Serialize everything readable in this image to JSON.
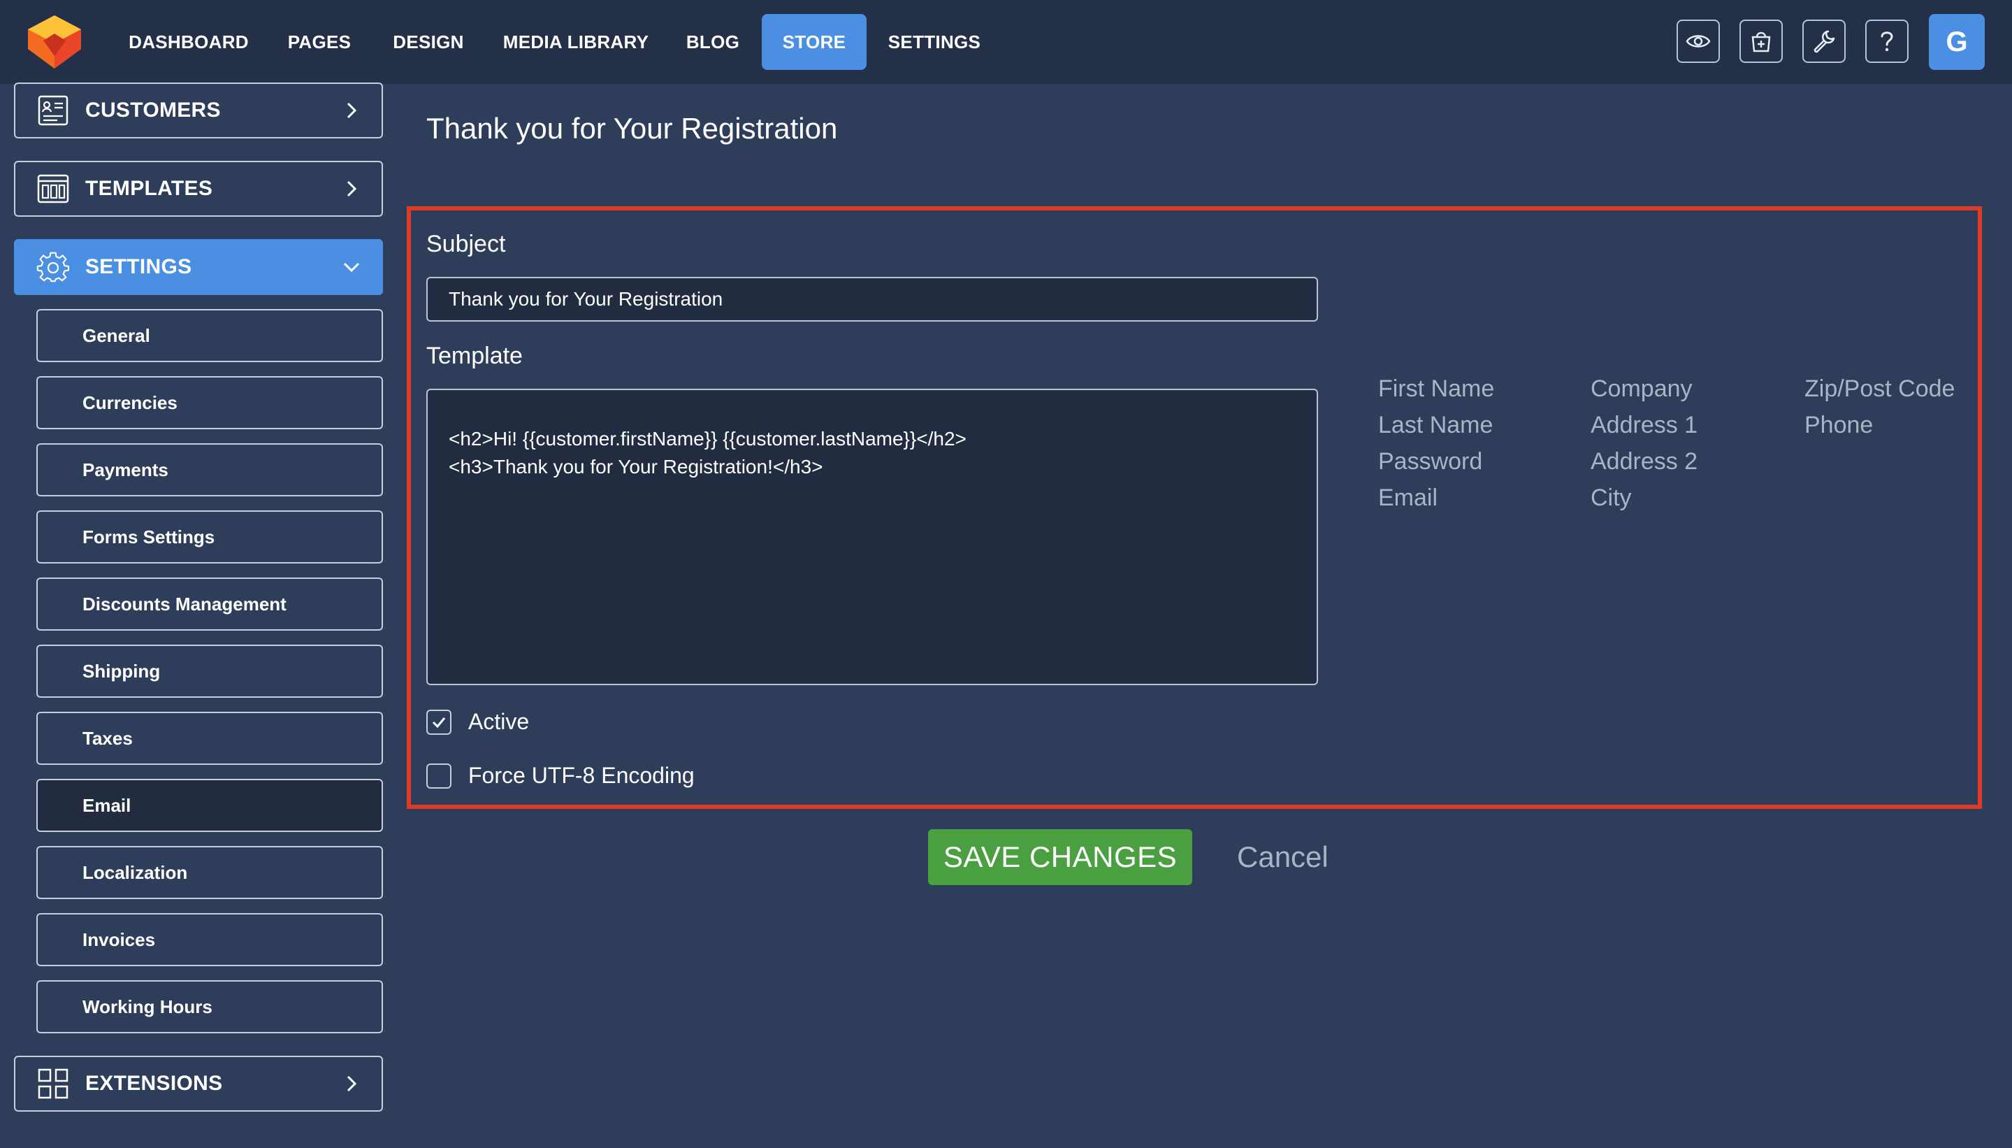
{
  "nav": {
    "items": [
      {
        "label": "DASHBOARD"
      },
      {
        "label": "PAGES"
      },
      {
        "label": "DESIGN"
      },
      {
        "label": "MEDIA LIBRARY"
      },
      {
        "label": "BLOG"
      },
      {
        "label": "STORE",
        "active": true
      },
      {
        "label": "SETTINGS"
      }
    ],
    "tools": [
      "eye-icon",
      "store-add-icon",
      "wrench-icon",
      "help-icon"
    ],
    "avatar_letter": "G"
  },
  "sidebar": {
    "sections": {
      "customers": "CUSTOMERS",
      "templates": "TEMPLATES",
      "settings": "SETTINGS",
      "extensions": "EXTENSIONS"
    },
    "settings_items": [
      "General",
      "Currencies",
      "Payments",
      "Forms Settings",
      "Discounts Management",
      "Shipping",
      "Taxes",
      "Email",
      "Localization",
      "Invoices",
      "Working Hours"
    ],
    "selected_item": "Email"
  },
  "main": {
    "title": "Thank you for Your Registration",
    "subject_label": "Subject",
    "subject_value": "Thank you for Your Registration",
    "template_label": "Template",
    "template_value": "<h2>Hi! {{customer.firstName}} {{customer.lastName}}</h2>\n<h3>Thank you for Your Registration!</h3>",
    "variables": {
      "col1": [
        "First Name",
        "Last Name",
        "Password",
        "Email"
      ],
      "col2": [
        "Company",
        "Address 1",
        "Address 2",
        "City"
      ],
      "col3": [
        "Zip/Post Code",
        "Phone"
      ]
    },
    "active_label": "Active",
    "active_checked": true,
    "utf8_label": "Force UTF-8 Encoding",
    "utf8_checked": false,
    "save_label": "SAVE CHANGES",
    "cancel_label": "Cancel"
  },
  "colors": {
    "background": "#2e3e5a",
    "topbar": "#233047",
    "accent": "#4a8fe2",
    "save": "#4aa040",
    "highlight_frame": "#e03a26"
  }
}
